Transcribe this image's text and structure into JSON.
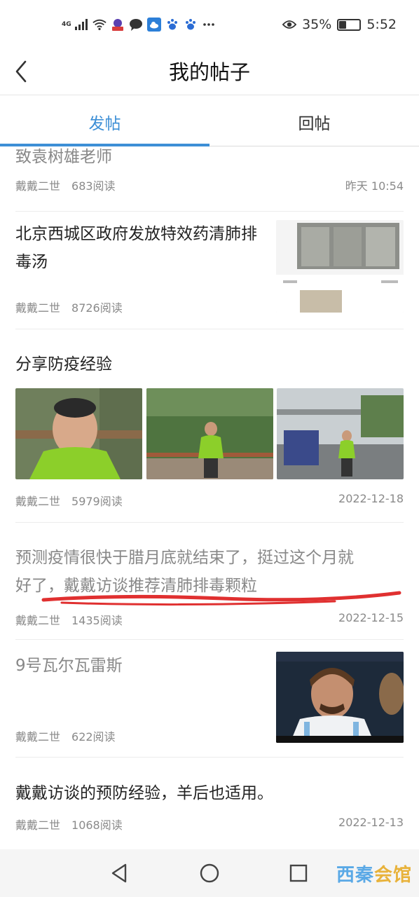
{
  "status_bar": {
    "network": "4G",
    "battery": "35%",
    "battery_level": 0.35,
    "time": "5:52",
    "icons": [
      "signal-icon",
      "wifi-icon",
      "app-badge-icon",
      "chat-bubble-icon",
      "cloud-icon",
      "paw-icon",
      "paw-icon",
      "more-dots-icon",
      "eye-icon"
    ]
  },
  "header": {
    "title": "我的帖子",
    "back_icon": "chevron-left-icon"
  },
  "tabs": [
    {
      "label": "发帖",
      "active": true
    },
    {
      "label": "回帖",
      "active": false
    }
  ],
  "posts": [
    {
      "title": "致袁树雄老师",
      "author": "戴戴二世",
      "reads": "683阅读",
      "date": "昨天 10:54"
    },
    {
      "title": "北京西城区政府发放特效药清肺排毒汤",
      "author": "戴戴二世",
      "reads": "8726阅读",
      "date": ""
    },
    {
      "title": "分享防疫经验",
      "author": "戴戴二世",
      "reads": "5979阅读",
      "date": "2022-12-18"
    },
    {
      "title_line1": "预测疫情很快于腊月底就结束了，挺过这个月就",
      "title_line2": "好了，戴戴访谈推荐清肺排毒颗粒",
      "author": "戴戴二世",
      "reads": "1435阅读",
      "date": "2022-12-15"
    },
    {
      "title": "9号瓦尔瓦雷斯",
      "author": "戴戴二世",
      "reads": "622阅读",
      "date": ""
    },
    {
      "title": "戴戴访谈的预防经验，羊后也适用。",
      "author": "戴戴二世",
      "reads": "1068阅读",
      "date": "2022-12-13"
    }
  ],
  "navbar": {
    "back": "triangle-back-icon",
    "home": "circle-home-icon",
    "recent": "square-recent-icon"
  },
  "watermark": {
    "part1": "西秦",
    "part2": "会馆"
  },
  "colors": {
    "accent": "#3d8fd6",
    "annotation_red": "#e03030",
    "watermark_gold": "#e8b23a"
  }
}
